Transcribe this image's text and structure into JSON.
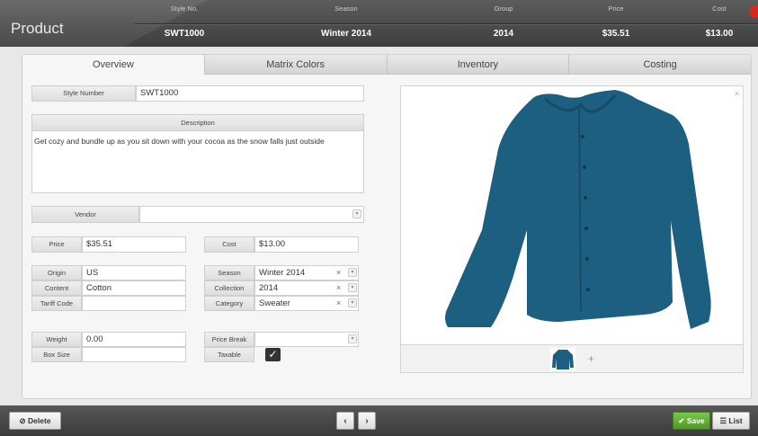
{
  "header": {
    "title": "Product",
    "columns": [
      {
        "label": "Style No.",
        "value": "SWT1000"
      },
      {
        "label": "Season",
        "value": "Winter 2014"
      },
      {
        "label": "Group",
        "value": "2014"
      },
      {
        "label": "Price",
        "value": "$35.51"
      },
      {
        "label": "Cost",
        "value": "$13.00"
      }
    ]
  },
  "tabs": [
    "Overview",
    "Matrix Colors",
    "Inventory",
    "Costing"
  ],
  "form": {
    "style_number": {
      "label": "Style Number",
      "value": "SWT1000"
    },
    "description": {
      "label": "Description",
      "value": "Get cozy and bundle up as you sit down with your cocoa as the snow falls just outside"
    },
    "vendor": {
      "label": "Vendor",
      "value": ""
    },
    "price": {
      "label": "Price",
      "value": "$35.51"
    },
    "cost": {
      "label": "Cost",
      "value": "$13.00"
    },
    "origin": {
      "label": "Origin",
      "value": "US"
    },
    "content": {
      "label": "Content",
      "value": "Cotton"
    },
    "tariff_code": {
      "label": "Tariff Code",
      "value": ""
    },
    "season": {
      "label": "Season",
      "value": "Winter 2014"
    },
    "collection": {
      "label": "Collection",
      "value": "2014"
    },
    "category": {
      "label": "Category",
      "value": "Sweater"
    },
    "weight": {
      "label": "Weight",
      "value": "0.00"
    },
    "box_size": {
      "label": "Box Size",
      "value": ""
    },
    "price_break": {
      "label": "Price Break",
      "value": ""
    },
    "taxable": {
      "label": "Taxable",
      "checked": true
    }
  },
  "footer": {
    "delete_label": "Delete",
    "prev_label": "‹",
    "next_label": "›",
    "save_label": "Save",
    "list_label": "List"
  },
  "colors": {
    "accent_green": "#5aa82e",
    "sweater_blue": "#1d5f80",
    "close_red": "#d62a20"
  }
}
